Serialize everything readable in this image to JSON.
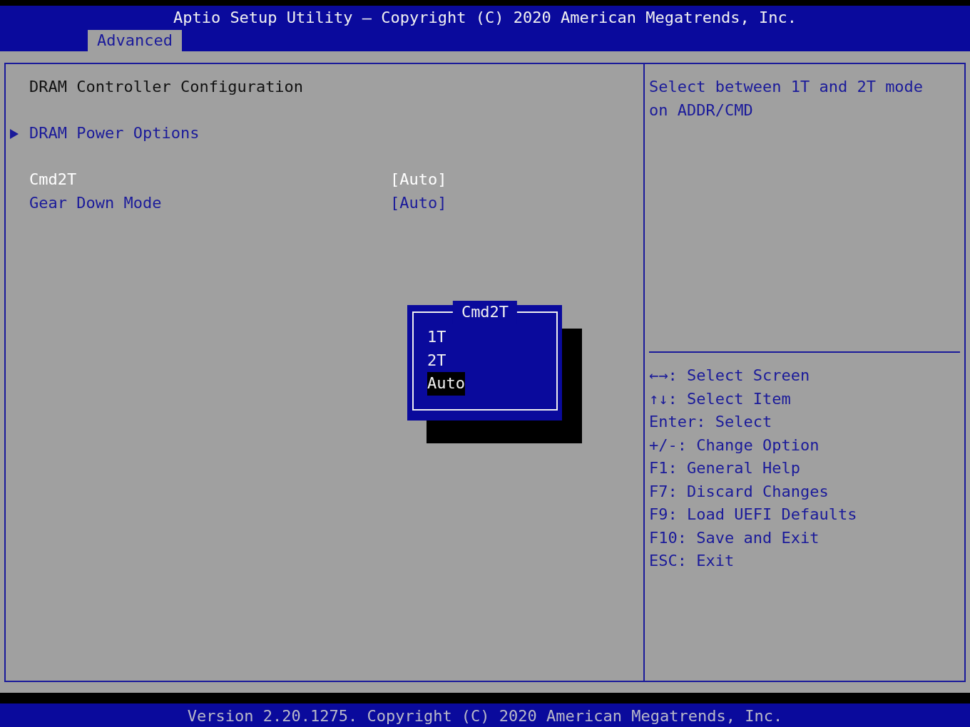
{
  "header": {
    "title": "Aptio Setup Utility – Copyright (C) 2020 American Megatrends, Inc.",
    "tabs": [
      {
        "label": "Advanced",
        "selected": true
      }
    ]
  },
  "main": {
    "items": [
      {
        "kind": "heading",
        "label": "DRAM Controller Configuration"
      },
      {
        "kind": "submenu",
        "label": "DRAM Power Options",
        "selected": false
      },
      {
        "kind": "setting",
        "label": "Cmd2T",
        "value": "[Auto]",
        "selected": true
      },
      {
        "kind": "setting",
        "label": "Gear Down Mode",
        "value": "[Auto]",
        "selected": false
      }
    ]
  },
  "help": {
    "description": [
      "Select between 1T and 2T mode",
      "on ADDR/CMD"
    ],
    "keys": [
      "←→: Select Screen",
      "↑↓: Select Item",
      "Enter: Select",
      "+/-: Change Option",
      "F1: General Help",
      "F7: Discard Changes",
      "F9: Load UEFI Defaults",
      "F10: Save and Exit",
      "ESC: Exit"
    ]
  },
  "popup": {
    "title": "Cmd2T",
    "options": [
      {
        "label": "1T",
        "selected": false
      },
      {
        "label": "2T",
        "selected": false
      },
      {
        "label": "Auto",
        "selected": true
      }
    ]
  },
  "footer": {
    "text": "Version 2.20.1275. Copyright (C) 2020 American Megatrends, Inc."
  }
}
